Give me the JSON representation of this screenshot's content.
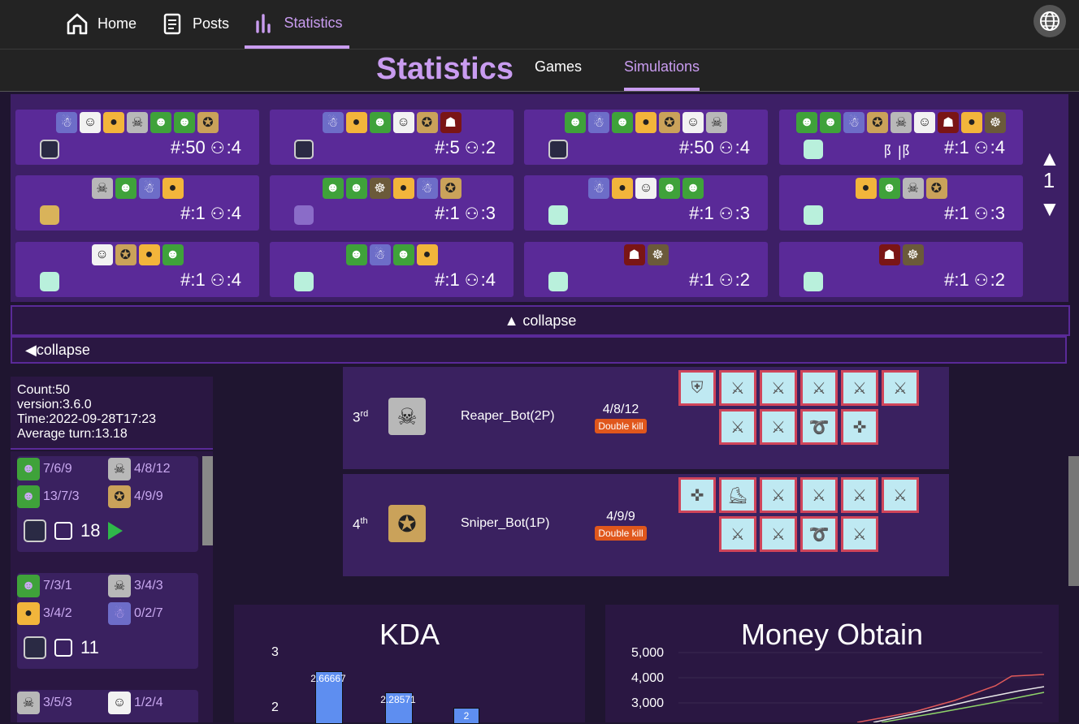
{
  "nav": {
    "home": "Home",
    "posts": "Posts",
    "statistics": "Statistics"
  },
  "header": {
    "title": "Statistics",
    "tabs": [
      "Games",
      "Simulations"
    ],
    "active_tab": "Simulations"
  },
  "simulations": [
    {
      "chars": [
        "purple",
        "white",
        "yellow",
        "grey",
        "green",
        "green",
        "tan"
      ],
      "item": "clock",
      "count": "#:50",
      "players": ":4"
    },
    {
      "chars": [
        "purple",
        "yellow",
        "green",
        "white",
        "tan",
        "red"
      ],
      "item": "clock",
      "count": "#:5",
      "players": ":2"
    },
    {
      "chars": [
        "green",
        "purple",
        "green",
        "yellow",
        "tan",
        "white",
        "grey"
      ],
      "item": "clock",
      "count": "#:50",
      "players": ":4"
    },
    {
      "chars": [
        "green",
        "green",
        "purple",
        "tan",
        "grey",
        "white",
        "red",
        "yellow",
        "dark"
      ],
      "item": "mint",
      "count": "#:1",
      "players": ":4",
      "mid": "阝|阝"
    },
    {
      "chars": [
        "grey",
        "green",
        "purple",
        "yellow"
      ],
      "item": "gold",
      "count": "#:1",
      "players": ":4"
    },
    {
      "chars": [
        "green",
        "green",
        "dark",
        "yellow",
        "purple",
        "tan"
      ],
      "item": "flame",
      "count": "#:1",
      "players": ":3"
    },
    {
      "chars": [
        "purple",
        "yellow",
        "white",
        "green",
        "green"
      ],
      "item": "mint",
      "count": "#:1",
      "players": ":3"
    },
    {
      "chars": [
        "yellow",
        "green",
        "grey",
        "tan"
      ],
      "item": "mint",
      "count": "#:1",
      "players": ":3"
    },
    {
      "chars": [
        "white",
        "tan",
        "yellow",
        "green"
      ],
      "item": "mint",
      "count": "#:1",
      "players": ":4"
    },
    {
      "chars": [
        "green",
        "purple",
        "green",
        "yellow"
      ],
      "item": "mint",
      "count": "#:1",
      "players": ":4"
    },
    {
      "chars": [
        "red",
        "dark"
      ],
      "item": "mint",
      "count": "#:1",
      "players": ":2"
    },
    {
      "chars": [
        "red",
        "dark"
      ],
      "item": "mint",
      "count": "#:1",
      "players": ":2"
    }
  ],
  "pager": {
    "up": "▲",
    "page": "1",
    "down": "▼"
  },
  "collapse_top": "▲ collapse",
  "collapse_left": "◀collapse",
  "summary": {
    "count": "Count:50",
    "version": "version:3.6.0",
    "time": "Time:2022-09-28T17:23",
    "avg_turn": "Average turn:13.18"
  },
  "games": [
    {
      "players": [
        {
          "c": "green",
          "kda": "7/6/9"
        },
        {
          "c": "grey",
          "kda": "4/8/12"
        },
        {
          "c": "green",
          "kda": "13/7/3"
        },
        {
          "c": "tan",
          "kda": "4/9/9"
        }
      ],
      "turns": "18",
      "play": true
    },
    {
      "players": [
        {
          "c": "green",
          "kda": "7/3/1"
        },
        {
          "c": "grey",
          "kda": "3/4/3"
        },
        {
          "c": "yellow",
          "kda": "3/4/2"
        },
        {
          "c": "purple",
          "kda": "0/2/7"
        }
      ],
      "turns": "11",
      "play": false
    },
    {
      "players": [
        {
          "c": "grey",
          "kda": "3/5/3"
        },
        {
          "c": "white",
          "kda": "1/2/4"
        }
      ],
      "turns": "",
      "play": false
    }
  ],
  "rankings": [
    {
      "pos": "3",
      "suffix": "rd",
      "name": "Reaper_Bot(2P)",
      "kda": "4/8/12",
      "badge": "Double kill",
      "avatar": "grey"
    },
    {
      "pos": "4",
      "suffix": "th",
      "name": "Sniper_Bot(1P)",
      "kda": "4/9/9",
      "badge": "Double kill",
      "avatar": "tan"
    }
  ],
  "chart_data": [
    {
      "type": "bar",
      "title": "KDA",
      "ticks": [
        "3",
        "2"
      ],
      "values": [
        2.66667,
        2.28571,
        2
      ],
      "labels": [
        "2.66667",
        "2.28571",
        "2"
      ]
    },
    {
      "type": "line",
      "title": "Money Obtain",
      "ticks": [
        "5,000",
        "4,000",
        "3,000"
      ]
    }
  ]
}
